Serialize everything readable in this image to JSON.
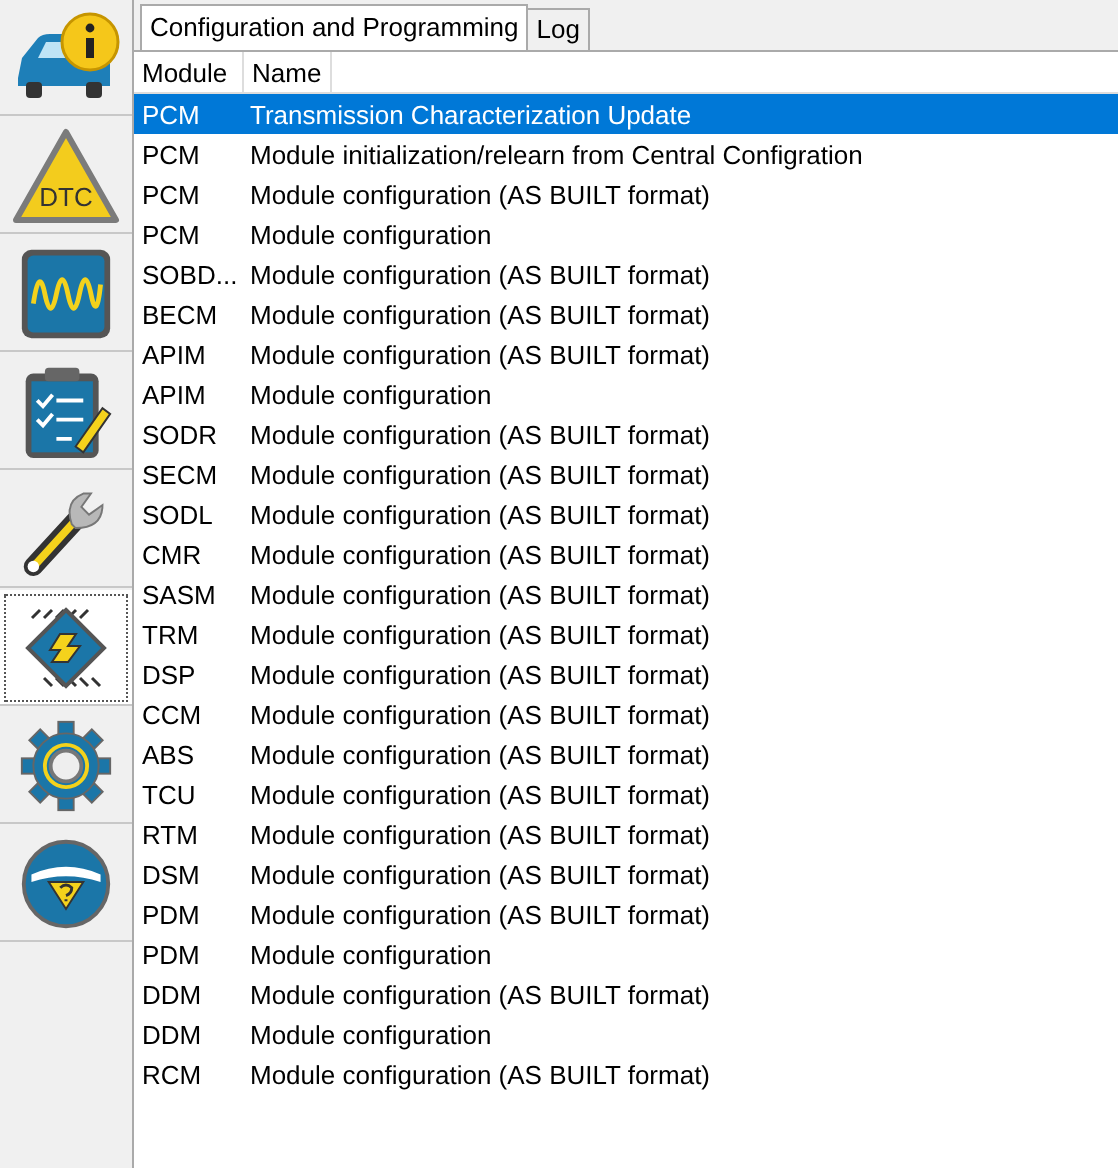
{
  "sidebar": {
    "items": [
      {
        "kind": "info",
        "selected": false
      },
      {
        "kind": "dtc",
        "label": "DTC",
        "selected": false
      },
      {
        "kind": "scope",
        "selected": false
      },
      {
        "kind": "checklist",
        "selected": false
      },
      {
        "kind": "wrench",
        "selected": false
      },
      {
        "kind": "module",
        "selected": true
      },
      {
        "kind": "gear",
        "selected": false
      },
      {
        "kind": "help",
        "selected": false
      }
    ]
  },
  "tabs": [
    {
      "label": "Configuration and Programming",
      "selected": true
    },
    {
      "label": "Log",
      "selected": false
    }
  ],
  "table": {
    "columns": [
      "Module",
      "Name"
    ],
    "rows": [
      {
        "module": "PCM",
        "name": "Transmission Characterization Update",
        "selected": true
      },
      {
        "module": "PCM",
        "name": "Module initialization/relearn from Central Configration",
        "selected": false
      },
      {
        "module": "PCM",
        "name": "Module configuration (AS BUILT format)",
        "selected": false
      },
      {
        "module": "PCM",
        "name": "Module configuration",
        "selected": false
      },
      {
        "module": "SOBD...",
        "name": "Module configuration (AS BUILT format)",
        "selected": false
      },
      {
        "module": "BECM",
        "name": "Module configuration (AS BUILT format)",
        "selected": false
      },
      {
        "module": "APIM",
        "name": "Module configuration (AS BUILT format)",
        "selected": false
      },
      {
        "module": "APIM",
        "name": "Module configuration",
        "selected": false
      },
      {
        "module": "SODR",
        "name": "Module configuration (AS BUILT format)",
        "selected": false
      },
      {
        "module": "SECM",
        "name": "Module configuration (AS BUILT format)",
        "selected": false
      },
      {
        "module": "SODL",
        "name": "Module configuration (AS BUILT format)",
        "selected": false
      },
      {
        "module": "CMR",
        "name": "Module configuration (AS BUILT format)",
        "selected": false
      },
      {
        "module": "SASM",
        "name": "Module configuration (AS BUILT format)",
        "selected": false
      },
      {
        "module": "TRM",
        "name": "Module configuration (AS BUILT format)",
        "selected": false
      },
      {
        "module": "DSP",
        "name": "Module configuration (AS BUILT format)",
        "selected": false
      },
      {
        "module": "CCM",
        "name": "Module configuration (AS BUILT format)",
        "selected": false
      },
      {
        "module": "ABS",
        "name": "Module configuration (AS BUILT format)",
        "selected": false
      },
      {
        "module": "TCU",
        "name": "Module configuration (AS BUILT format)",
        "selected": false
      },
      {
        "module": "RTM",
        "name": "Module configuration (AS BUILT format)",
        "selected": false
      },
      {
        "module": "DSM",
        "name": "Module configuration (AS BUILT format)",
        "selected": false
      },
      {
        "module": "PDM",
        "name": "Module configuration (AS BUILT format)",
        "selected": false
      },
      {
        "module": "PDM",
        "name": "Module configuration",
        "selected": false
      },
      {
        "module": "DDM",
        "name": "Module configuration (AS BUILT format)",
        "selected": false
      },
      {
        "module": "DDM",
        "name": "Module configuration",
        "selected": false
      },
      {
        "module": "RCM",
        "name": "Module configuration (AS BUILT format)",
        "selected": false
      }
    ]
  }
}
